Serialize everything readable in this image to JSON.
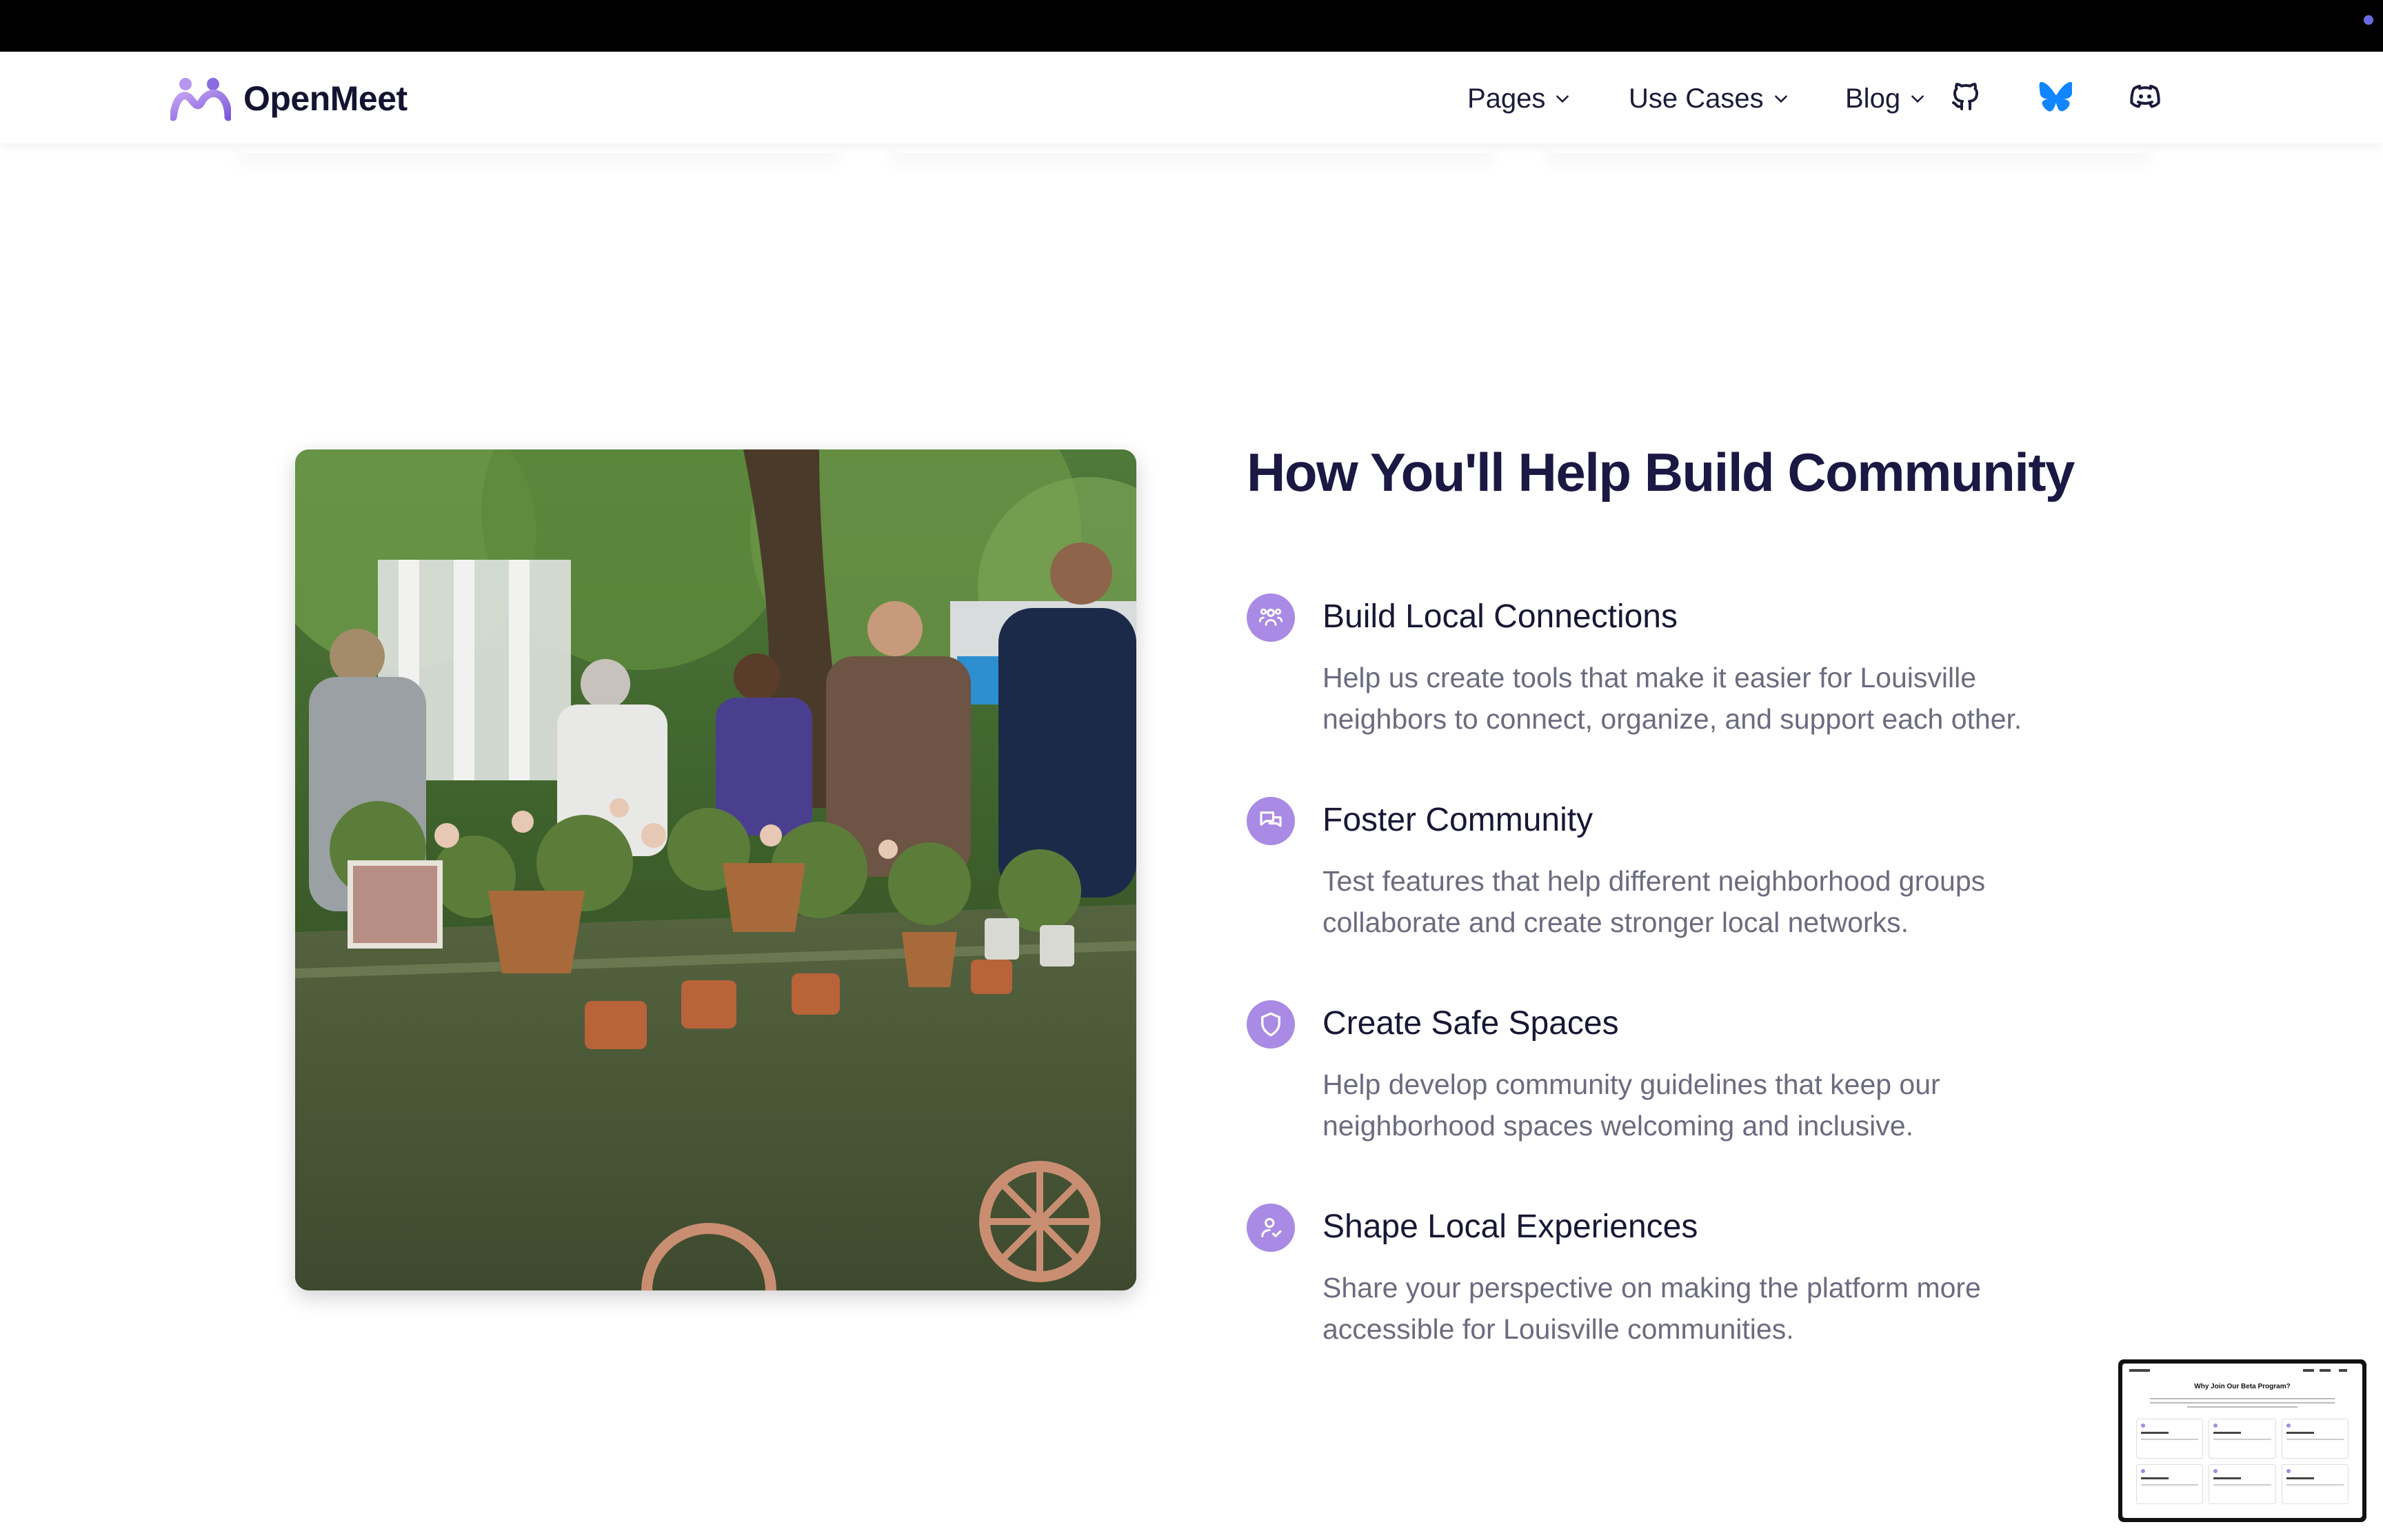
{
  "brand": {
    "name": "OpenMeet"
  },
  "nav": {
    "items": [
      {
        "label": "Pages",
        "icon": "chevron-down-icon"
      },
      {
        "label": "Use Cases",
        "icon": "chevron-down-icon"
      },
      {
        "label": "Blog",
        "icon": "chevron-down-icon"
      }
    ],
    "social": [
      "github-icon",
      "bluesky-icon",
      "discord-icon"
    ]
  },
  "section": {
    "heading": "How You'll Help Build Community",
    "image": "community-market-photo",
    "features": [
      {
        "icon": "people-icon",
        "title": "Build Local Connections",
        "description": "Help us create tools that make it easier for Louisville neighbors to connect, organize, and support each other."
      },
      {
        "icon": "chat-icon",
        "title": "Foster Community",
        "description": "Test features that help different neighborhood groups collaborate and create stronger local networks."
      },
      {
        "icon": "shield-icon",
        "title": "Create Safe Spaces",
        "description": "Help develop community guidelines that keep our neighborhood spaces welcoming and inclusive."
      },
      {
        "icon": "user-check-icon",
        "title": "Shape Local Experiences",
        "description": "Share your perspective on making the platform more accessible for Louisville communities."
      }
    ]
  },
  "preview": {
    "title": "Why Join Our Beta Program?"
  },
  "colors": {
    "accent": "#a98ae4",
    "heading": "#1b1844",
    "body": "#6b6b80",
    "bluesky": "#1185fe"
  }
}
